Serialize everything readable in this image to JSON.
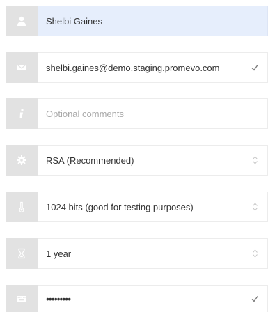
{
  "form": {
    "name": {
      "value": "Shelbi Gaines",
      "icon": "user-icon"
    },
    "email": {
      "value": "shelbi.gaines@demo.staging.promevo.com",
      "icon": "envelope-icon",
      "status_icon": "checkmark-icon"
    },
    "comments": {
      "value": "",
      "placeholder": "Optional comments",
      "icon": "info-icon"
    },
    "algorithm": {
      "selected": "RSA (Recommended)",
      "icon": "gear-icon"
    },
    "key_size": {
      "selected": "1024 bits (good for testing purposes)",
      "icon": "thermometer-icon"
    },
    "expiration": {
      "selected": "1 year",
      "icon": "hourglass-icon"
    },
    "passphrase": {
      "masked_value": "•••••••••",
      "icon": "keyboard-icon",
      "status_icon": "checkmark-icon"
    }
  },
  "colors": {
    "focused_field_bg": "#e6eefc",
    "icon_box_bg": "#e2e2e2",
    "icon_color": "#ffffff",
    "text": "#333333",
    "placeholder": "#a9a9a9"
  }
}
